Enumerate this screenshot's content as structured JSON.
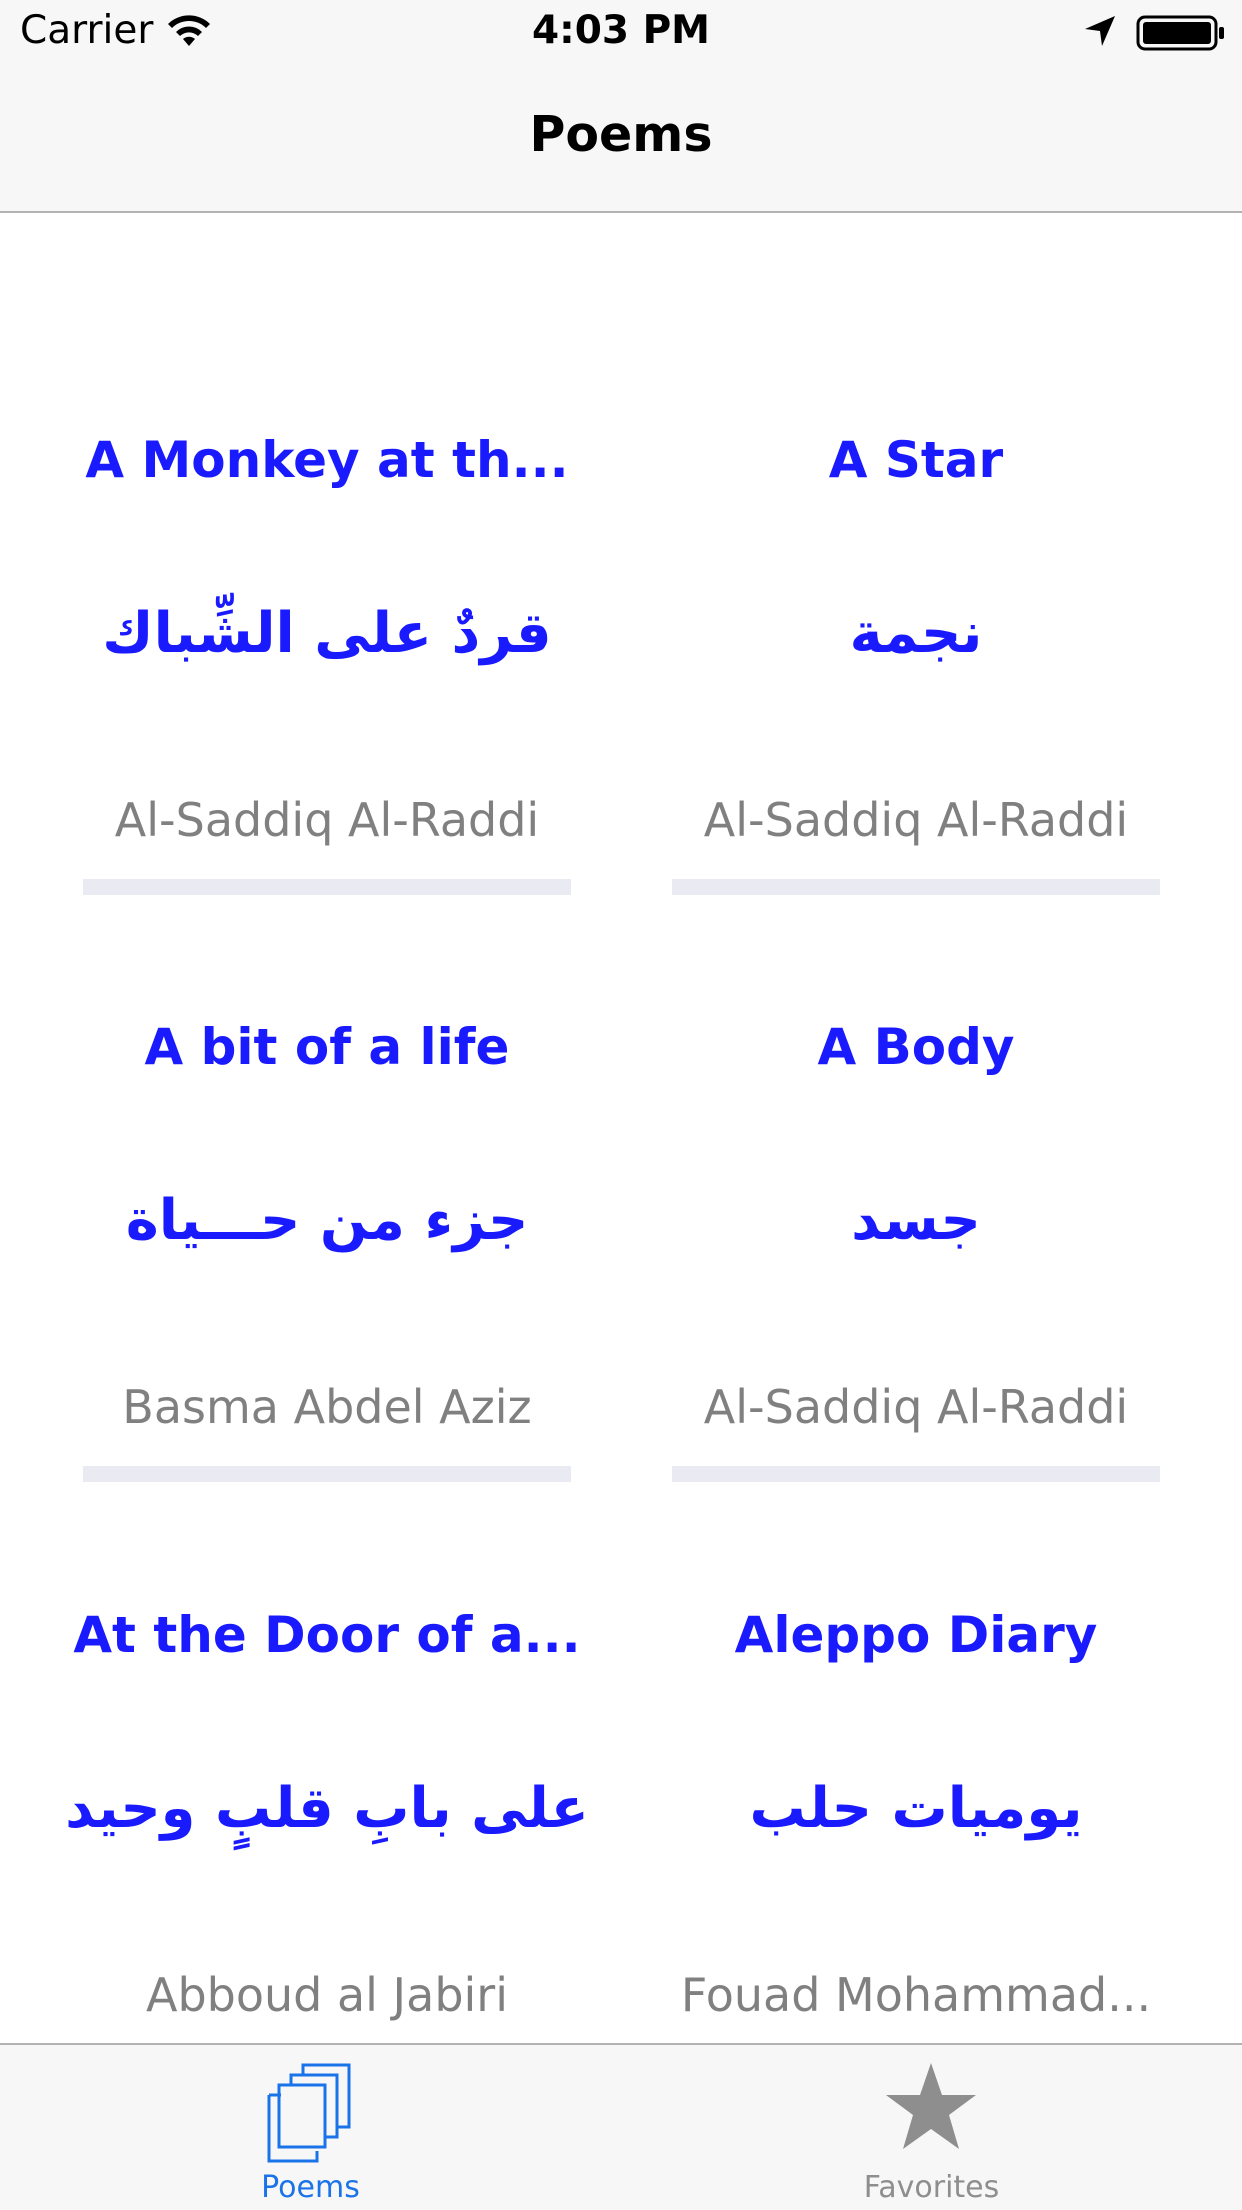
{
  "status_bar": {
    "carrier": "Carrier",
    "time": "4:03 PM"
  },
  "nav": {
    "title": "Poems"
  },
  "poems": [
    {
      "title": "A Monkey at th...",
      "arabic": "قردٌ على الشِّباك",
      "author": "Al-Saddiq Al-Raddi"
    },
    {
      "title": "A Star",
      "arabic": "نجمة",
      "author": "Al-Saddiq Al-Raddi"
    },
    {
      "title": "A bit of a life",
      "arabic": "جزء من حـــياة",
      "author": "Basma Abdel Aziz"
    },
    {
      "title": "A Body",
      "arabic": "جسد",
      "author": "Al-Saddiq Al-Raddi"
    },
    {
      "title": "At the Door of a...",
      "arabic": "على بابِ قلبٍ وحيد",
      "author": "Abboud al Jabiri"
    },
    {
      "title": "Aleppo Diary",
      "arabic": "يوميات حلب",
      "author": "Fouad Mohammad..."
    }
  ],
  "tab_bar": {
    "tabs": [
      {
        "label": "Poems",
        "icon": "documents-icon",
        "selected": true
      },
      {
        "label": "Favorites",
        "icon": "star-icon",
        "selected": false
      }
    ]
  },
  "colors": {
    "accent": "#1a1aff",
    "tab_selected": "#1a73e8",
    "author_gray": "#808080",
    "bar_background": "#f7f7f7"
  }
}
